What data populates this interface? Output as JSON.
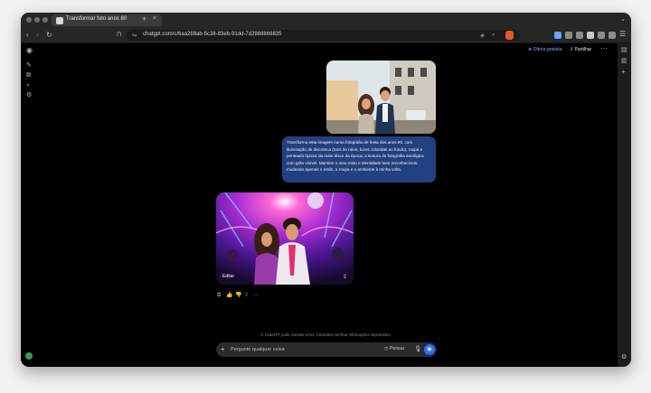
{
  "browser": {
    "tab_title": "Transformar foto anos 80",
    "tab_close": "×",
    "new_tab": "+",
    "url": "chatgpt.com/c/6aa268ab-5c38-83eb-91dd-7d2988866835",
    "back": "‹",
    "forward": "›",
    "reload": "↻",
    "tab_list": "⌄"
  },
  "header": {
    "offer_label": "⊕ Oferta gratuita",
    "share_label": "⇪ Partilhar",
    "more_label": "···"
  },
  "sidebar_icons": {
    "logo": "◉",
    "new_chat": "✎",
    "library": "⧉",
    "search": "⌕",
    "settings": "⚙"
  },
  "right_panel_icons": {
    "panel": "▤",
    "reader": "▥",
    "add": "+",
    "gear": "⚙"
  },
  "conversation": {
    "user_message": "Transforma esta imagem numa fotografia de festa dos anos 80, com iluminação de discoteca (tons de néon, luzes coloridas ao fundo), roupa e penteado típicos da noite disco da época, a textura de fotografia analógica com grão visível. Mantém o meu rosto e identidade bem reconhecíveis, mudando apenas o estilo, a roupa e o ambiente à minha volta.",
    "image_edit_label": "Editar",
    "image_share": "⇪",
    "actions": [
      "⧉",
      "👍",
      "👎",
      "⇪",
      "···"
    ]
  },
  "disclaimer": "O ChatGPT pode cometer erros. Considera verificar informações importantes.",
  "composer": {
    "plus": "+",
    "placeholder": "Pergunte qualquer coisa",
    "think_label": "◷ Pensar",
    "mic": "🎙",
    "voice": "◉"
  }
}
